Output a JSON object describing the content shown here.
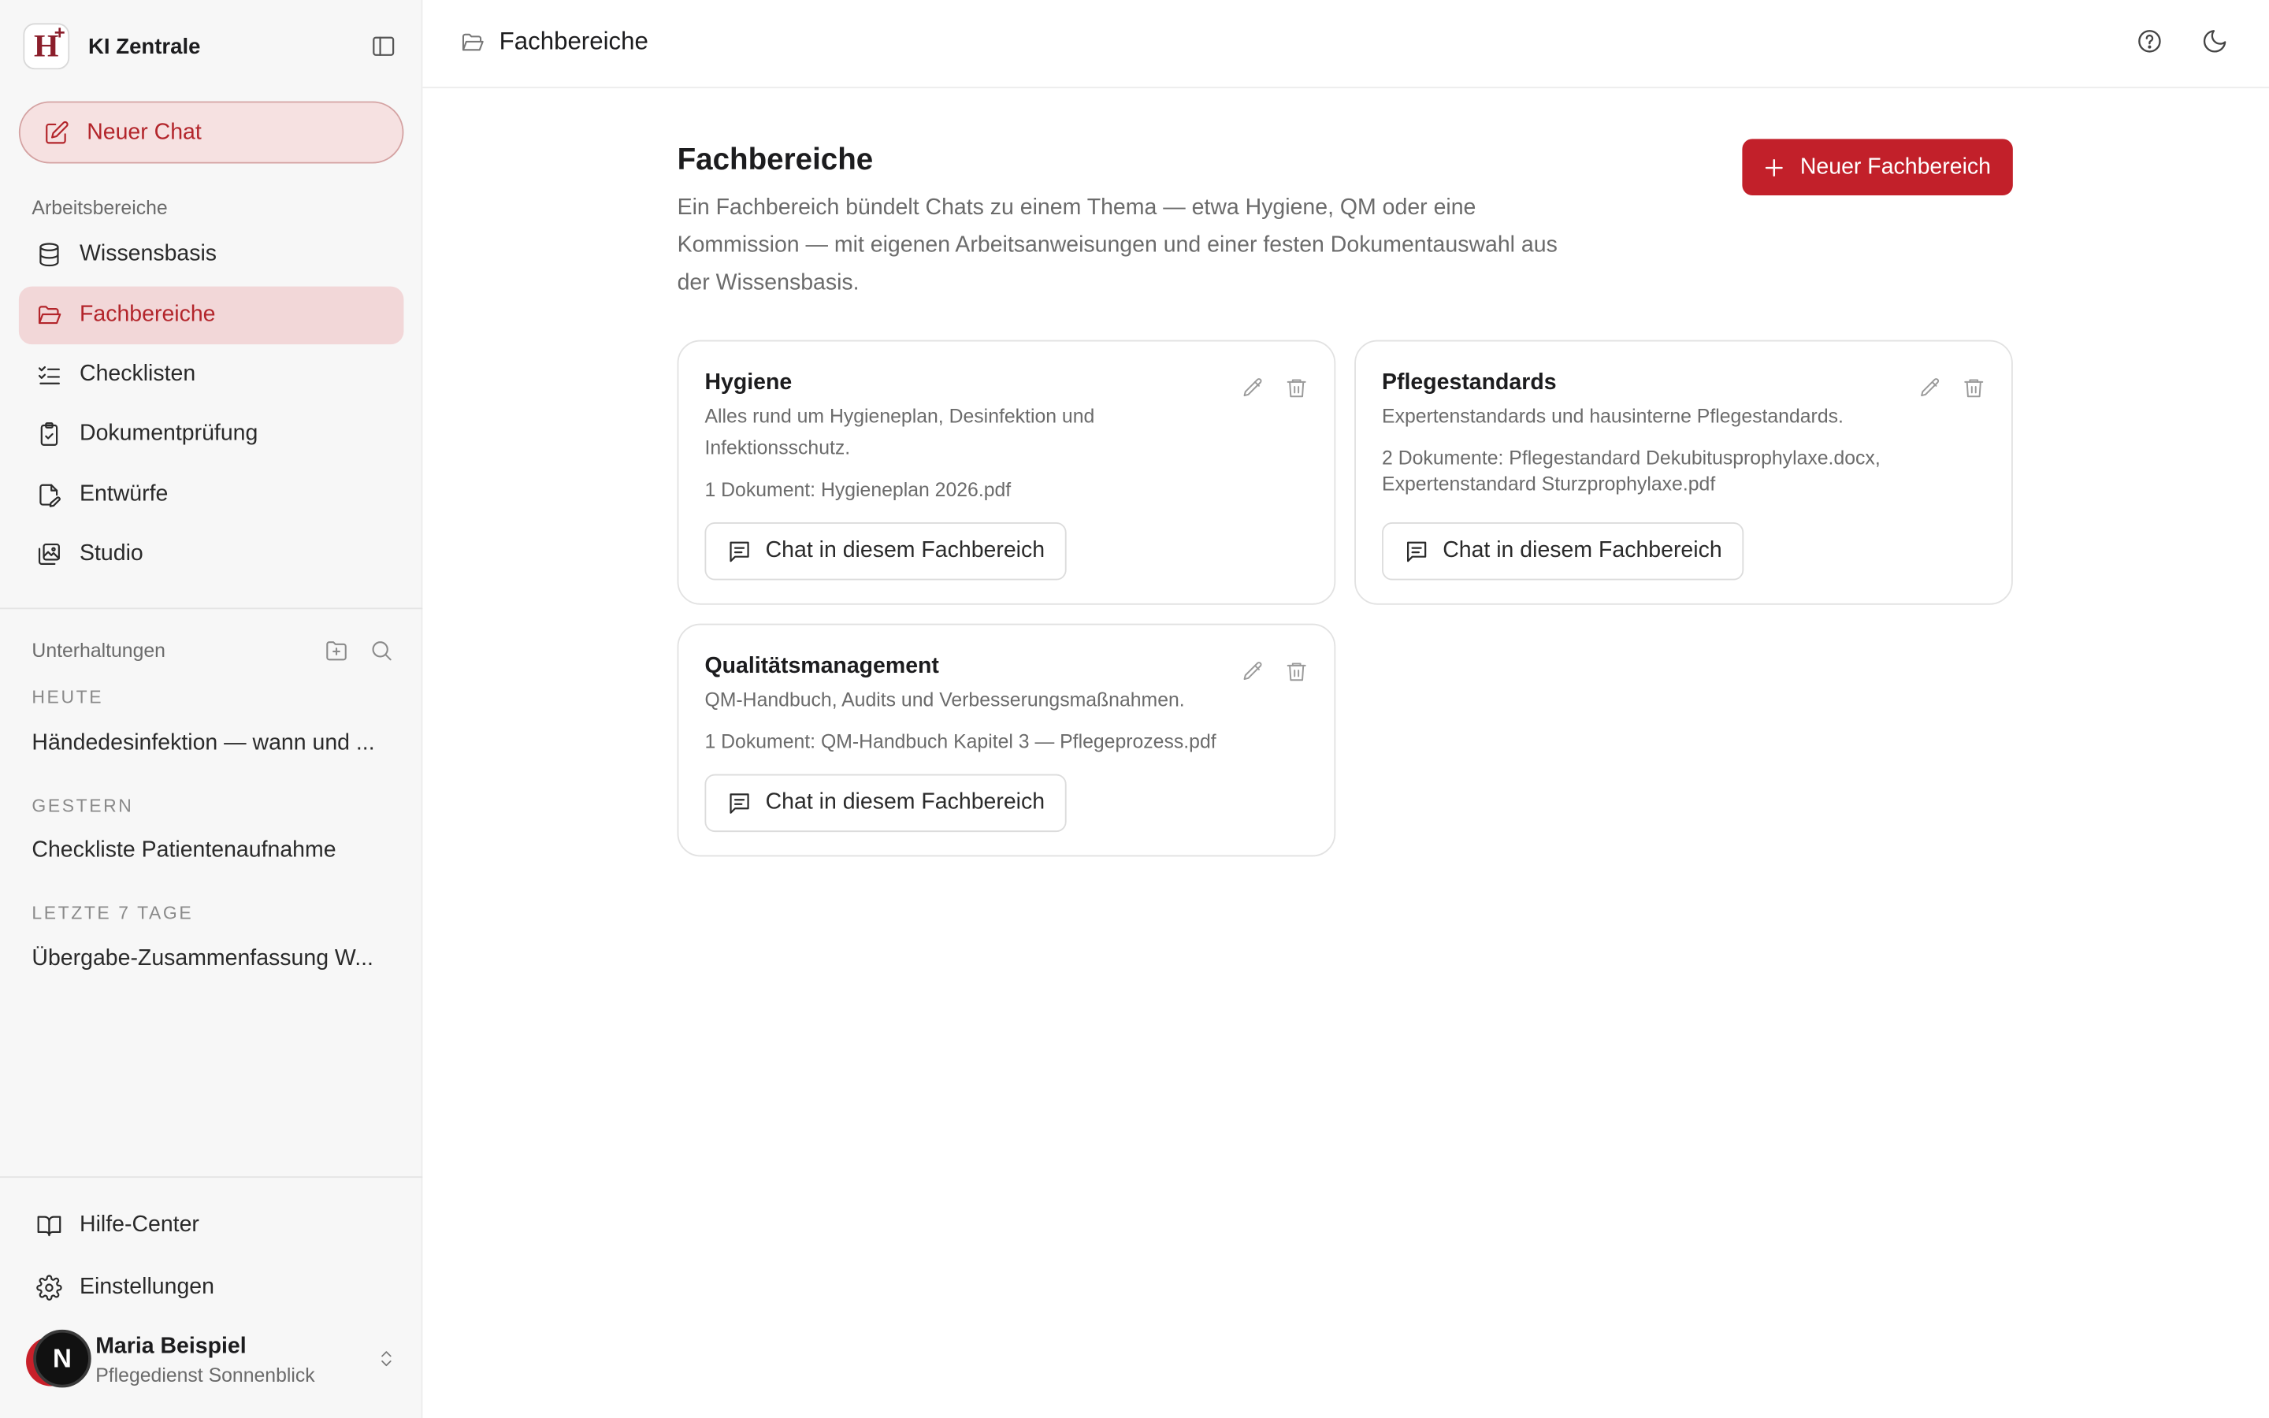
{
  "app": {
    "name": "KI Zentrale"
  },
  "sidebar": {
    "new_chat_label": "Neuer Chat",
    "workspaces_label": "Arbeitsbereiche",
    "nav": [
      {
        "label": "Wissensbasis",
        "icon": "database-icon",
        "active": false
      },
      {
        "label": "Fachbereiche",
        "icon": "folder-open-icon",
        "active": true
      },
      {
        "label": "Checklisten",
        "icon": "list-check-icon",
        "active": false
      },
      {
        "label": "Dokumentprüfung",
        "icon": "clipboard-check-icon",
        "active": false
      },
      {
        "label": "Entwürfe",
        "icon": "file-edit-icon",
        "active": false
      },
      {
        "label": "Studio",
        "icon": "image-gallery-icon",
        "active": false
      }
    ],
    "conversations_label": "Unterhaltungen",
    "groups": [
      {
        "label": "HEUTE",
        "items": [
          "Händedesinfektion — wann und ..."
        ]
      },
      {
        "label": "GESTERN",
        "items": [
          "Checkliste Patientenaufnahme"
        ]
      },
      {
        "label": "LETZTE 7 TAGE",
        "items": [
          "Übergabe-Zusammenfassung W..."
        ]
      }
    ],
    "footer": [
      {
        "label": "Hilfe-Center",
        "icon": "book-open-icon"
      },
      {
        "label": "Einstellungen",
        "icon": "gear-icon"
      }
    ],
    "user": {
      "initial": "N",
      "name": "Maria Beispiel",
      "org": "Pflegedienst Sonnenblick"
    }
  },
  "header": {
    "breadcrumb": "Fachbereiche"
  },
  "main": {
    "title": "Fachbereiche",
    "description": "Ein Fachbereich bündelt Chats zu einem Thema — etwa Hygiene, QM oder eine Kommission — mit eigenen Arbeitsanweisungen und einer festen Dokumentauswahl aus der Wissensbasis.",
    "new_button_label": "Neuer Fachbereich",
    "cards": [
      {
        "title": "Hygiene",
        "description": "Alles rund um Hygieneplan, Desinfektion und Infektionsschutz.",
        "documents": "1 Dokument: Hygieneplan 2026.pdf",
        "chat_button_label": "Chat in diesem Fachbereich"
      },
      {
        "title": "Pflegestandards",
        "description": "Expertenstandards und hausinterne Pflegestandards.",
        "documents": "2 Dokumente: Pflegestandard Dekubitusprophylaxe.docx, Expertenstandard Sturzprophylaxe.pdf",
        "chat_button_label": "Chat in diesem Fachbereich"
      },
      {
        "title": "Qualitätsmanagement",
        "description": "QM-Handbuch, Audits und Verbesserungsmaßnahmen.",
        "documents": "1 Dokument: QM-Handbuch Kapitel 3 — Pflegeprozess.pdf",
        "chat_button_label": "Chat in diesem Fachbereich"
      }
    ]
  },
  "colors": {
    "accent": "#c2202a",
    "accent_soft": "#f2d7d8",
    "sidebar_bg": "#f7f7f7"
  }
}
